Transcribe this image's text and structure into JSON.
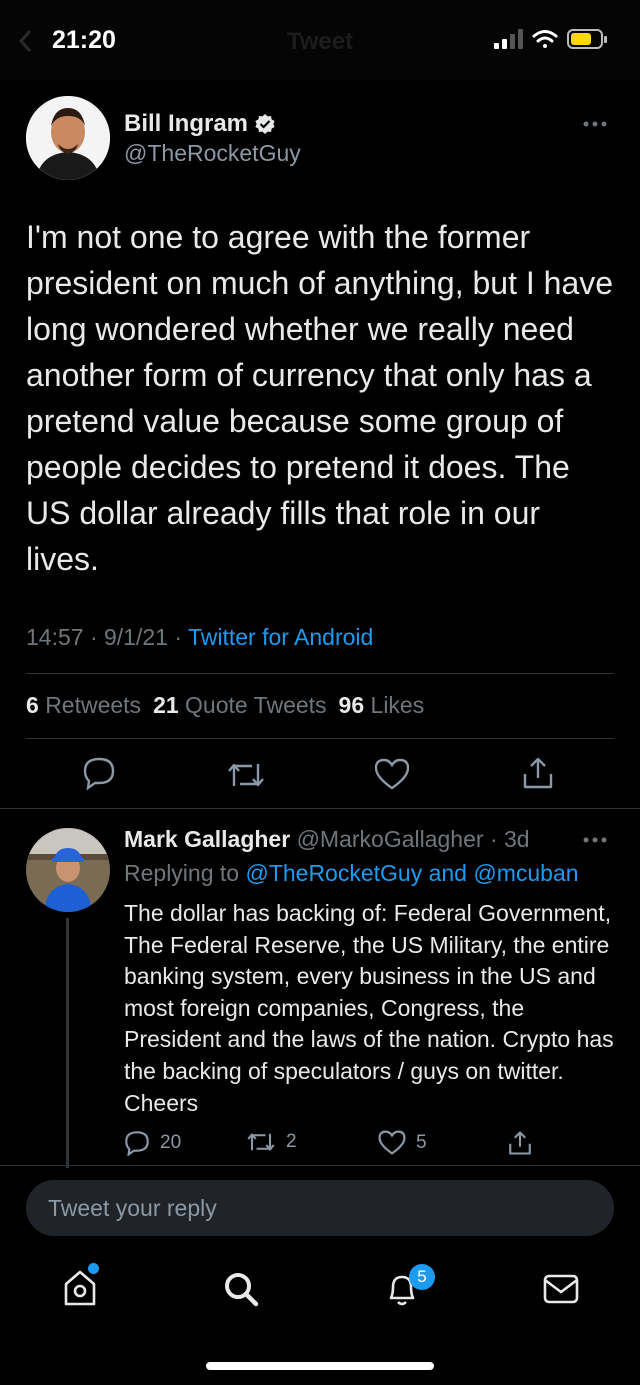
{
  "status_bar": {
    "time": "21:20",
    "nav_title": "Tweet"
  },
  "tweet": {
    "author": {
      "name": "Bill Ingram",
      "handle": "@TheRocketGuy",
      "verified": true
    },
    "text": "I'm not one to agree with the former president on much of anything, but I have long wondered whether we really need another form of currency that only has a pretend value because some group of people decides to pretend it does. The US dollar already fills that role in our lives.",
    "time": "14:57 · 9/1/21 · ",
    "source": "Twitter for Android",
    "stats": {
      "retweets_count": "6",
      "retweets_label": "Retweets",
      "quotes_count": "21",
      "quotes_label": "Quote Tweets",
      "likes_count": "96",
      "likes_label": "Likes"
    }
  },
  "reply": {
    "author_name": "Mark Gallagher",
    "handle_time": "@MarkoGallagher · 3d",
    "replying_prefix": "Replying to ",
    "replying_to": "@TheRocketGuy and @mcuban",
    "text": "The dollar has backing of: Federal Government, The Federal Reserve, the US Military, the entire banking system, every business in the US and most foreign companies, Congress, the President and the laws of the nation. Crypto has the backing of speculators / guys on twitter. Cheers",
    "counts": {
      "replies": "20",
      "retweets": "2",
      "likes": "5"
    }
  },
  "composer": {
    "placeholder": "Tweet your reply"
  },
  "tabbar": {
    "notifications_badge": "5"
  },
  "colors": {
    "accent": "#1d9bf0",
    "background": "#000000",
    "muted": "#71767b"
  },
  "icons": [
    "back-arrow-icon",
    "signal-icon",
    "wifi-icon",
    "battery-icon",
    "verified-icon",
    "more-icon",
    "reply-icon",
    "retweet-icon",
    "like-icon",
    "share-icon",
    "home-icon",
    "search-icon",
    "notifications-icon",
    "messages-icon"
  ]
}
